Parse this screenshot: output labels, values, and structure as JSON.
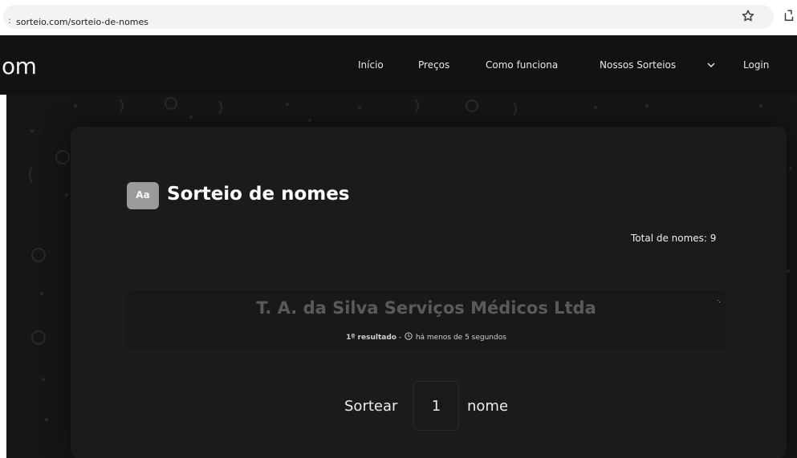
{
  "browser": {
    "left_glyph": ":",
    "url": "sorteio.com/sorteio-de-nomes"
  },
  "nav": {
    "logo_fragment": "om",
    "items": [
      "Início",
      "Preços",
      "Como funciona",
      "Nossos Sorteios",
      "Login"
    ]
  },
  "main": {
    "badge": "Aa",
    "title": "Sorteio de nomes",
    "total_names": "Total de nomes: 9",
    "result": {
      "name": "T. A. da Silva Serviços Médicos Ltda",
      "meta_prefix": "1º resultado",
      "meta_separator": " - ",
      "meta_time": "há menos de 5 segundos"
    },
    "draw": {
      "label_before": "Sortear",
      "quantity": "1",
      "label_after": "nome"
    }
  },
  "icons": {
    "star": "star-icon",
    "extension": "extension-icon",
    "chevron": "chevron-down-icon",
    "clock": "clock-icon",
    "sparkle": "sparkle-icon"
  }
}
